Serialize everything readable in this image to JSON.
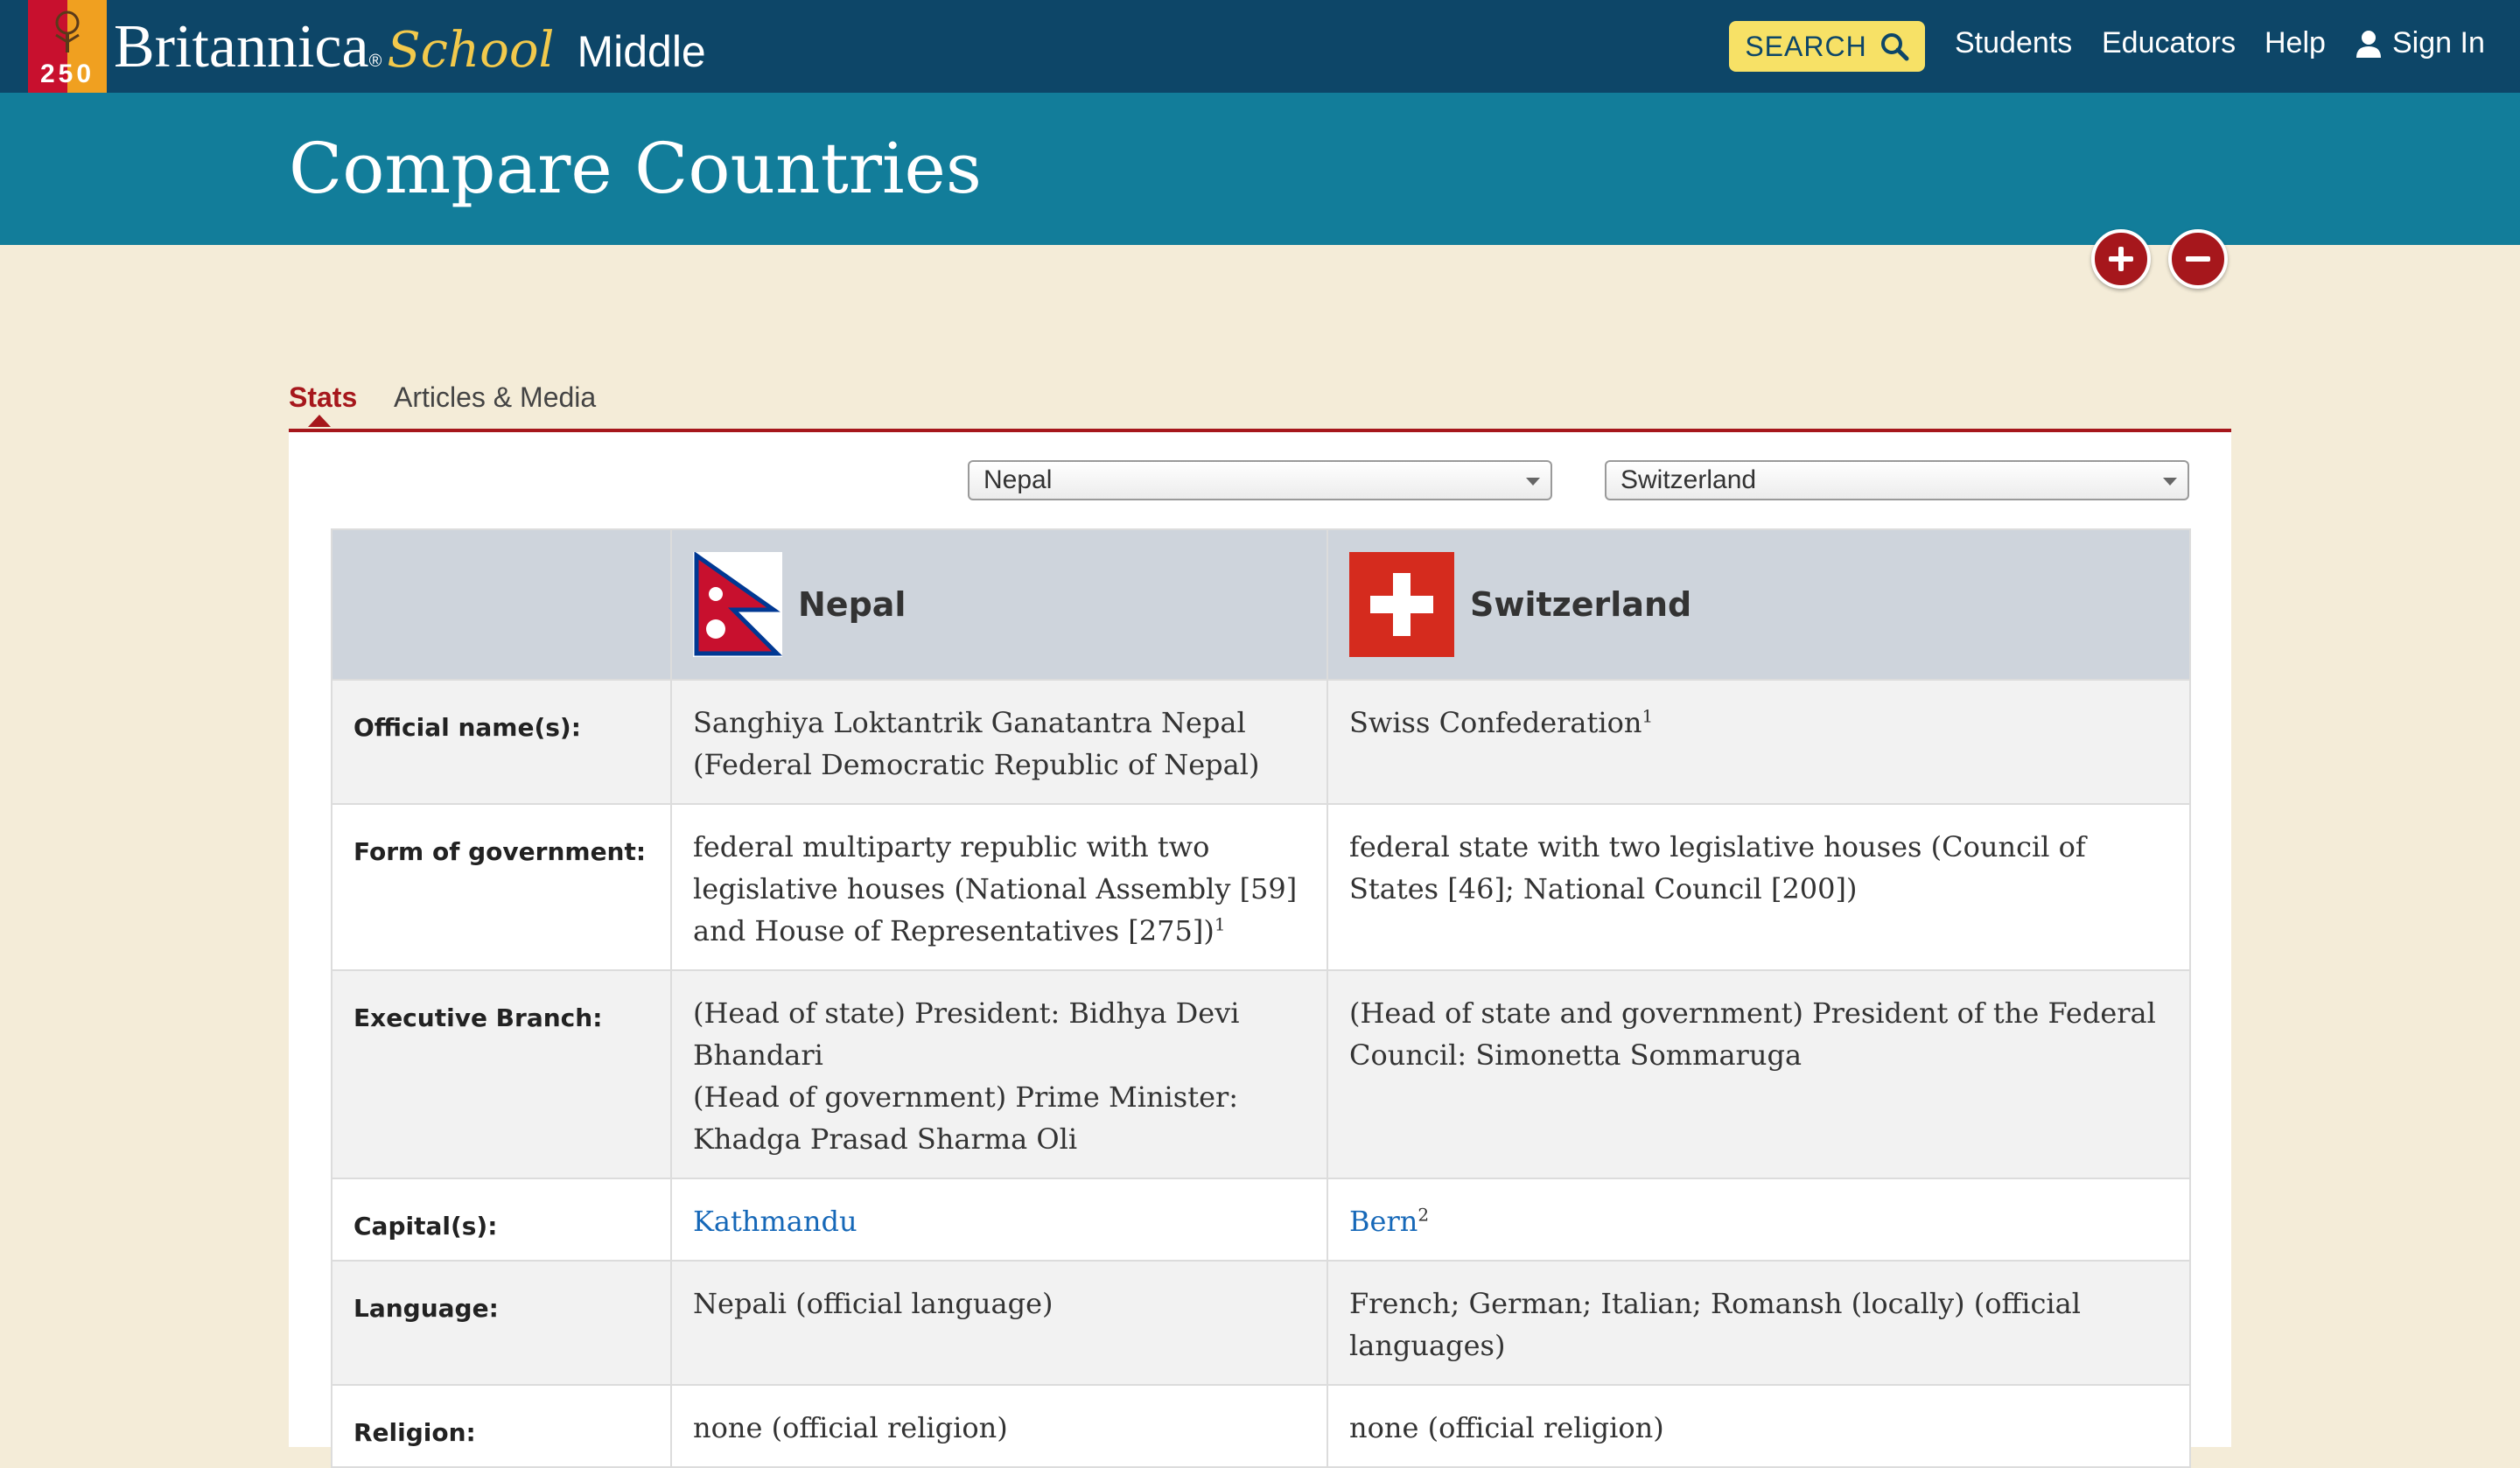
{
  "header": {
    "logo_number": "250",
    "brand_main": "Britannica",
    "brand_reg": "®",
    "brand_school": "School",
    "brand_level": "Middle",
    "search_label": "SEARCH",
    "nav": [
      "Students",
      "Educators",
      "Help"
    ],
    "signin_label": "Sign In"
  },
  "page": {
    "title": "Compare Countries"
  },
  "tabs": [
    {
      "label": "Stats",
      "active": true
    },
    {
      "label": "Articles & Media",
      "active": false
    }
  ],
  "selects": {
    "left": "Nepal",
    "right": "Switzerland"
  },
  "table": {
    "countries": [
      "Nepal",
      "Switzerland"
    ],
    "rows": [
      {
        "label": "Official name(s):",
        "nepal": [
          "Sanghiya Loktantrik Ganatantra Nepal (Federal Democratic Republic of Nepal)"
        ],
        "switzerland": [
          "Swiss Confederation"
        ],
        "switzerland_sup": "1"
      },
      {
        "label": "Form of government:",
        "nepal": [
          "federal multiparty republic with two legislative houses (National Assembly [59] and House of Representatives [275])"
        ],
        "nepal_sup": "1",
        "switzerland": [
          "federal state with two legislative houses (Council of States [46]; National Council [200])"
        ]
      },
      {
        "label": "Executive Branch:",
        "nepal": [
          "(Head of state) President: Bidhya Devi Bhandari",
          "(Head of government) Prime Minister: Khadga Prasad Sharma Oli"
        ],
        "switzerland": [
          "(Head of state and government) President of the Federal Council: Simonetta Sommaruga"
        ]
      },
      {
        "label": "Capital(s):",
        "nepal": [
          "Kathmandu"
        ],
        "switzerland": [
          "Bern"
        ],
        "switzerland_sup": "2"
      },
      {
        "label": "Language:",
        "nepal": [
          "Nepali (official language)"
        ],
        "switzerland": [
          "French; German; Italian; Romansh (locally) (official languages)"
        ]
      },
      {
        "label": "Religion:",
        "nepal": [
          "none (official religion)"
        ],
        "switzerland": [
          "none (official religion)"
        ]
      }
    ]
  },
  "colors": {
    "topbar": "#0d4668",
    "title_band": "#127d9a",
    "accent_red": "#a6171c",
    "search_yellow": "#f7e166",
    "link_blue": "#1668b8"
  },
  "icons": {
    "search": "search-icon",
    "user": "user-icon",
    "add": "plus-icon",
    "remove": "minus-icon"
  }
}
